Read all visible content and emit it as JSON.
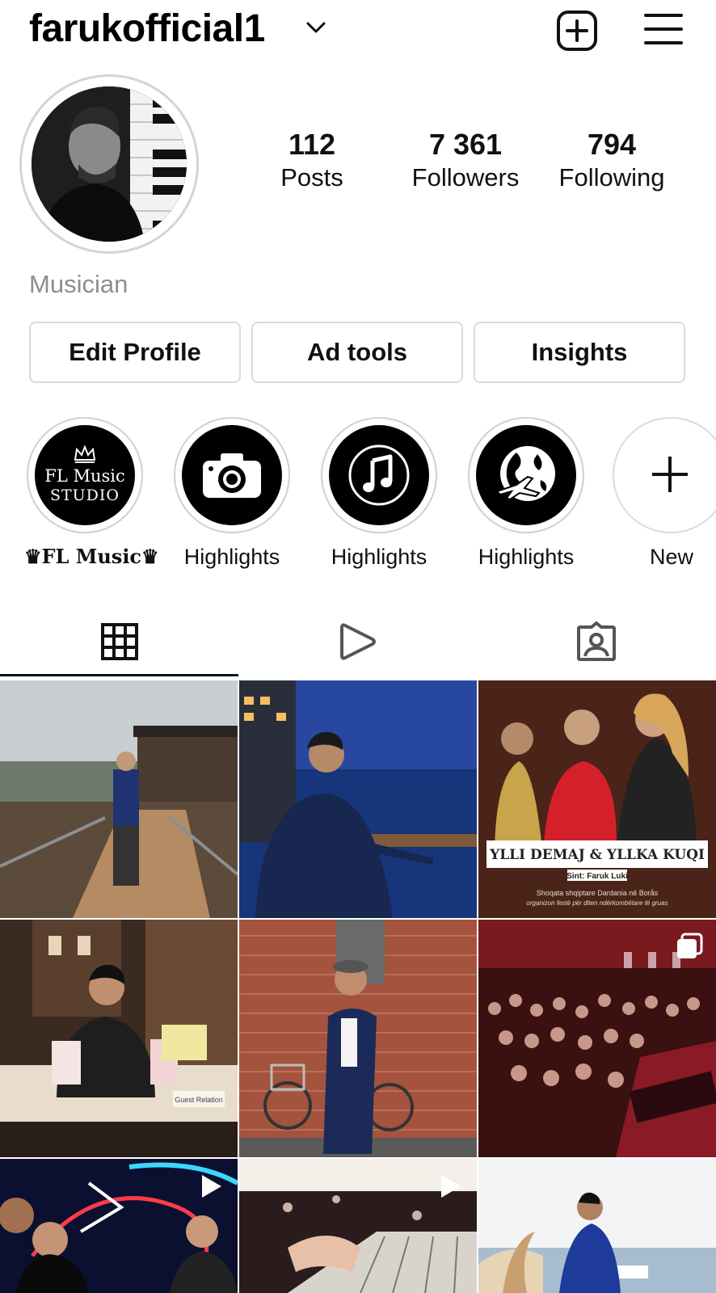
{
  "header": {
    "username": "farukofficial1",
    "icons": {
      "dropdown": "chevron-down-icon",
      "new_post": "plus-square-icon",
      "menu": "hamburger-menu-icon"
    }
  },
  "profile": {
    "stats": [
      {
        "value": "112",
        "label": "Posts"
      },
      {
        "value": "7 361",
        "label": "Followers"
      },
      {
        "value": "794",
        "label": "Following"
      }
    ],
    "category": "Musician",
    "avatar_art": "portrait-with-piano-icon"
  },
  "actions": {
    "edit_profile": "Edit Profile",
    "ad_tools": "Ad tools",
    "insights": "Insights"
  },
  "highlights": [
    {
      "label": "♛FL Music♛",
      "icon": "fl-music-studio-logo",
      "logo_text": [
        "FL Music",
        "STUDIO"
      ]
    },
    {
      "label": "Highlights",
      "icon": "camera-icon"
    },
    {
      "label": "Highlights",
      "icon": "music-note-icon"
    },
    {
      "label": "Highlights",
      "icon": "globe-plane-icon"
    },
    {
      "label": "New",
      "icon": "plus-icon"
    }
  ],
  "tabs": [
    {
      "name": "posts-grid",
      "icon": "grid-icon",
      "active": true
    },
    {
      "name": "reels",
      "icon": "play-icon",
      "active": false
    },
    {
      "name": "tagged",
      "icon": "tagged-person-icon",
      "active": false
    }
  ],
  "posts": {
    "poster": {
      "title": "YLLI DEMAJ & YLLKA KUQI",
      "subtitle": "Sint: Faruk Luki",
      "caption1": "Shoqata shqiptare Dardania në Borås",
      "caption2": "organizon festë për diten ndërkombëtare të gruas"
    },
    "desk_sign": "Guest Relation"
  },
  "colors": {
    "text": "#111111",
    "muted": "#8e8e8e",
    "border": "#dbdbdb",
    "accent_red": "#d4202a"
  }
}
